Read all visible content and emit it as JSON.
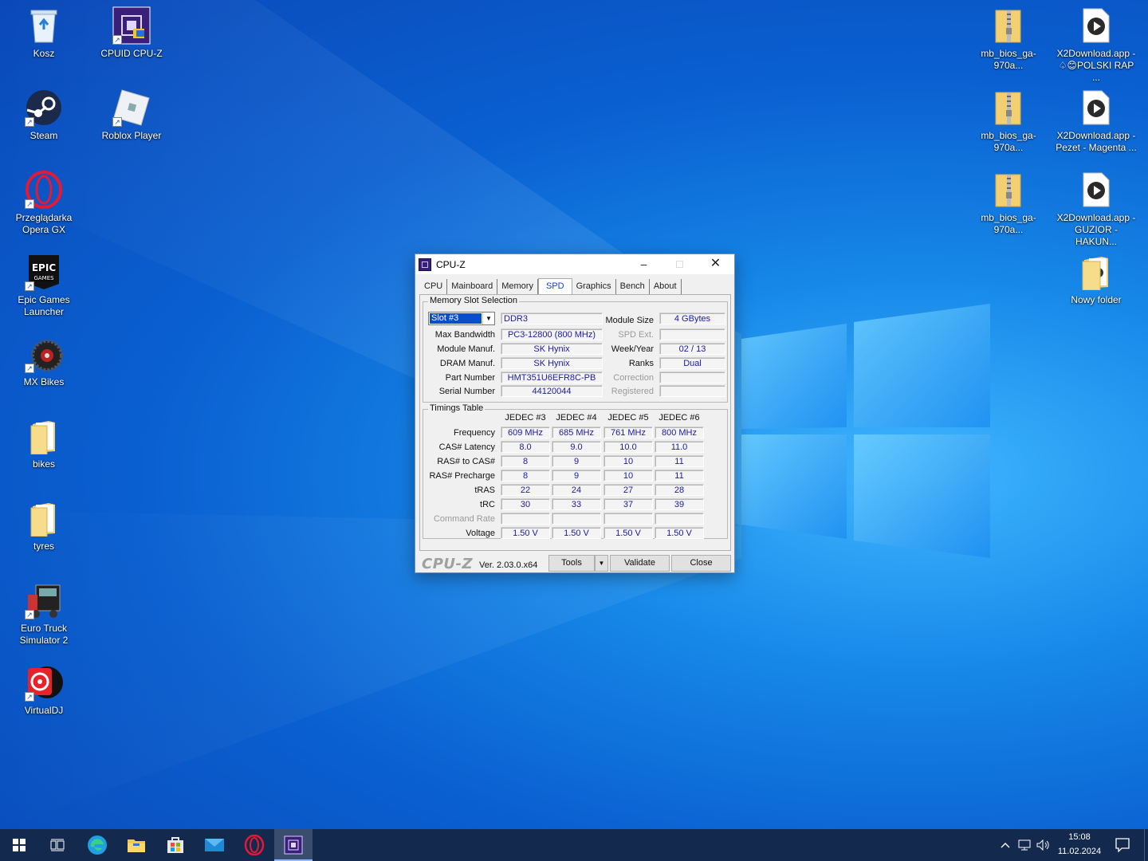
{
  "desktop": {
    "left_icons": [
      {
        "label": "Kosz",
        "icon": "recycle-bin-icon"
      },
      {
        "label": "Steam",
        "icon": "steam-icon"
      },
      {
        "label": "Przeglądarka Opera GX",
        "icon": "opera-gx-icon"
      },
      {
        "label": "Epic Games Launcher",
        "icon": "epic-games-icon"
      },
      {
        "label": "MX Bikes",
        "icon": "mx-bikes-icon"
      },
      {
        "label": "bikes",
        "icon": "folder-icon"
      },
      {
        "label": "tyres",
        "icon": "folder-icon"
      },
      {
        "label": "Euro Truck Simulator 2",
        "icon": "truck-icon"
      },
      {
        "label": "VirtualDJ",
        "icon": "virtualdj-icon"
      }
    ],
    "second_column_icons": [
      {
        "label": "CPUID CPU-Z",
        "icon": "cpuz-icon"
      },
      {
        "label": "Roblox Player",
        "icon": "roblox-icon"
      }
    ],
    "right_icons": [
      {
        "label": "mb_bios_ga-970a...",
        "icon": "zip-folder-icon"
      },
      {
        "label": "X2Download.app - ♤😊POLSKI RAP ...",
        "icon": "media-play-icon"
      },
      {
        "label": "mb_bios_ga-970a...",
        "icon": "zip-folder-icon"
      },
      {
        "label": "X2Download.app - Pezet - Magenta ...",
        "icon": "media-play-icon"
      },
      {
        "label": "mb_bios_ga-970a...",
        "icon": "zip-folder-icon"
      },
      {
        "label": "X2Download.app - GUZIOR - HAKUN...",
        "icon": "media-play-icon"
      },
      {
        "label": "Nowy folder",
        "icon": "folder-icon"
      }
    ]
  },
  "window": {
    "title": "CPU-Z",
    "tabs": [
      "CPU",
      "Mainboard",
      "Memory",
      "SPD",
      "Graphics",
      "Bench",
      "About"
    ],
    "active_tab": "SPD",
    "slot_group": {
      "title": "Memory Slot Selection",
      "selected_slot": "Slot #3",
      "type": "DDR3",
      "labels": {
        "max_bandwidth": "Max Bandwidth",
        "module_manuf": "Module Manuf.",
        "dram_manuf": "DRAM Manuf.",
        "part_number": "Part Number",
        "serial_number": "Serial Number",
        "module_size": "Module Size",
        "spd_ext": "SPD Ext.",
        "week_year": "Week/Year",
        "ranks": "Ranks",
        "correction": "Correction",
        "registered": "Registered"
      },
      "values": {
        "max_bandwidth": "PC3-12800 (800 MHz)",
        "module_manuf": "SK Hynix",
        "dram_manuf": "SK Hynix",
        "part_number": "HMT351U6EFR8C-PB",
        "serial_number": "44120044",
        "module_size": "4 GBytes",
        "spd_ext": "",
        "week_year": "02 / 13",
        "ranks": "Dual",
        "correction": "",
        "registered": ""
      }
    },
    "timings": {
      "title": "Timings Table",
      "columns": [
        "JEDEC #3",
        "JEDEC #4",
        "JEDEC #5",
        "JEDEC #6"
      ],
      "rows": [
        {
          "label": "Frequency",
          "values": [
            "609 MHz",
            "685 MHz",
            "761 MHz",
            "800 MHz"
          ],
          "dim": false
        },
        {
          "label": "CAS# Latency",
          "values": [
            "8.0",
            "9.0",
            "10.0",
            "11.0"
          ],
          "dim": false
        },
        {
          "label": "RAS# to CAS#",
          "values": [
            "8",
            "9",
            "10",
            "11"
          ],
          "dim": false
        },
        {
          "label": "RAS# Precharge",
          "values": [
            "8",
            "9",
            "10",
            "11"
          ],
          "dim": false
        },
        {
          "label": "tRAS",
          "values": [
            "22",
            "24",
            "27",
            "28"
          ],
          "dim": false
        },
        {
          "label": "tRC",
          "values": [
            "30",
            "33",
            "37",
            "39"
          ],
          "dim": false
        },
        {
          "label": "Command Rate",
          "values": [
            "",
            "",
            "",
            ""
          ],
          "dim": true
        },
        {
          "label": "Voltage",
          "values": [
            "1.50 V",
            "1.50 V",
            "1.50 V",
            "1.50 V"
          ],
          "dim": false
        }
      ]
    },
    "bottom": {
      "logo": "CPU-Z",
      "version": "Ver. 2.03.0.x64",
      "tools_label": "Tools",
      "validate_label": "Validate",
      "close_label": "Close"
    }
  },
  "taskbar": {
    "apps": [
      "windows-start-icon",
      "task-view-icon",
      "edge-icon",
      "file-explorer-icon",
      "store-icon",
      "mail-icon",
      "opera-gx-icon",
      "cpuz-icon"
    ],
    "time": "15:08",
    "date": "11.02.2024"
  }
}
